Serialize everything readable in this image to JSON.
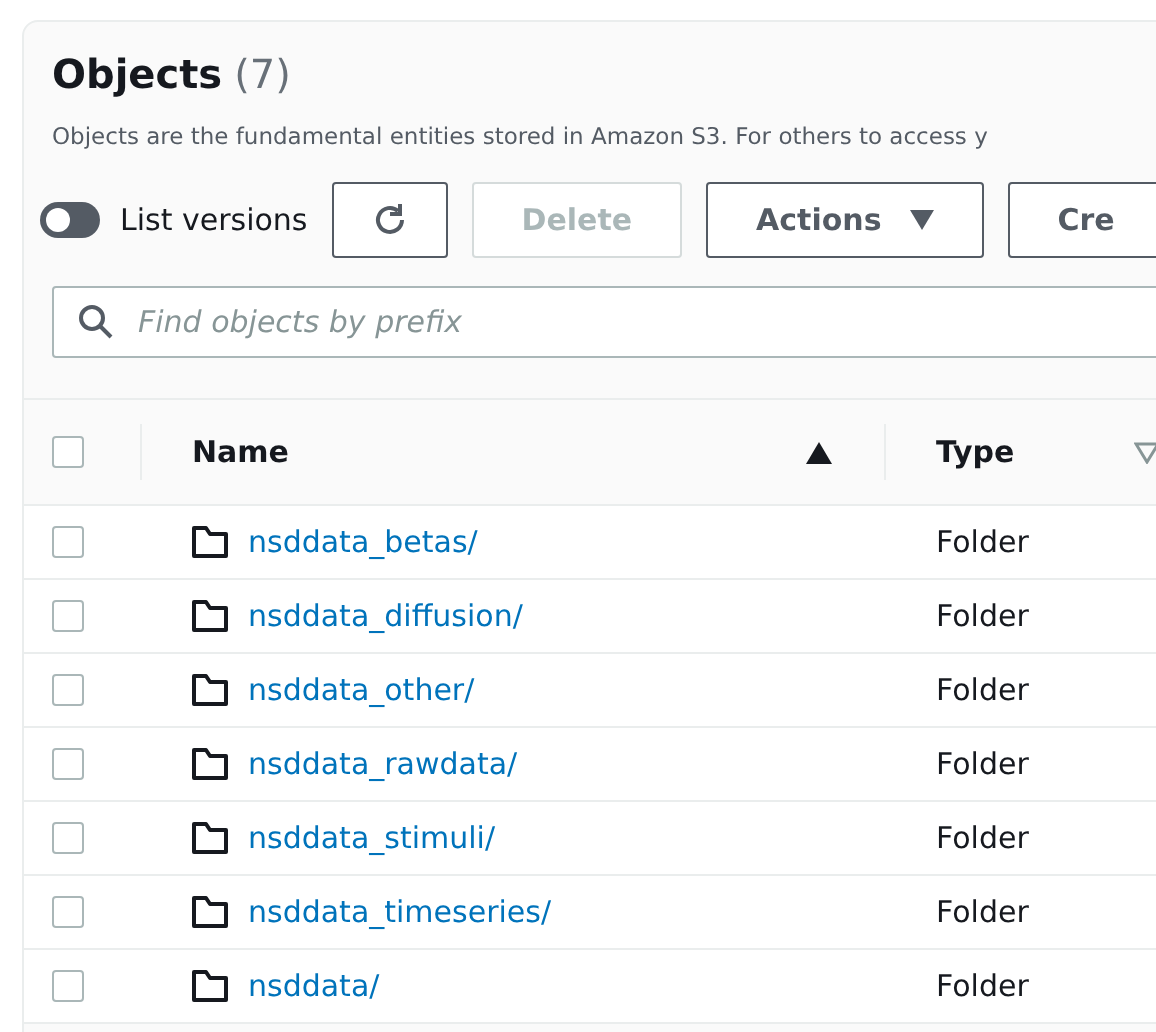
{
  "panel": {
    "title": "Objects",
    "count": "(7)",
    "description": "Objects are the fundamental entities stored in Amazon S3. For others to access y"
  },
  "toolbar": {
    "toggle": {
      "label": "List versions",
      "on": false
    },
    "buttons": [
      {
        "kind": "refresh",
        "disabled": false
      },
      {
        "kind": "text",
        "label": "Delete",
        "disabled": true
      },
      {
        "kind": "dropdown",
        "label": "Actions",
        "disabled": false
      },
      {
        "kind": "text",
        "label": "Cre",
        "disabled": false
      }
    ]
  },
  "search": {
    "placeholder": "Find objects by prefix"
  },
  "table": {
    "select_all": {
      "checked": false
    },
    "columns": [
      {
        "label": "Name",
        "sorted": true
      },
      {
        "label": "Type",
        "sorted": false
      }
    ],
    "rows": [
      {
        "name": "nsddata_betas/",
        "type": "Folder",
        "checked": false
      },
      {
        "name": "nsddata_diffusion/",
        "type": "Folder",
        "checked": false
      },
      {
        "name": "nsddata_other/",
        "type": "Folder",
        "checked": false
      },
      {
        "name": "nsddata_rawdata/",
        "type": "Folder",
        "checked": false
      },
      {
        "name": "nsddata_stimuli/",
        "type": "Folder",
        "checked": false
      },
      {
        "name": "nsddata_timeseries/",
        "type": "Folder",
        "checked": false
      },
      {
        "name": "nsddata/",
        "type": "Folder",
        "checked": false
      }
    ]
  }
}
